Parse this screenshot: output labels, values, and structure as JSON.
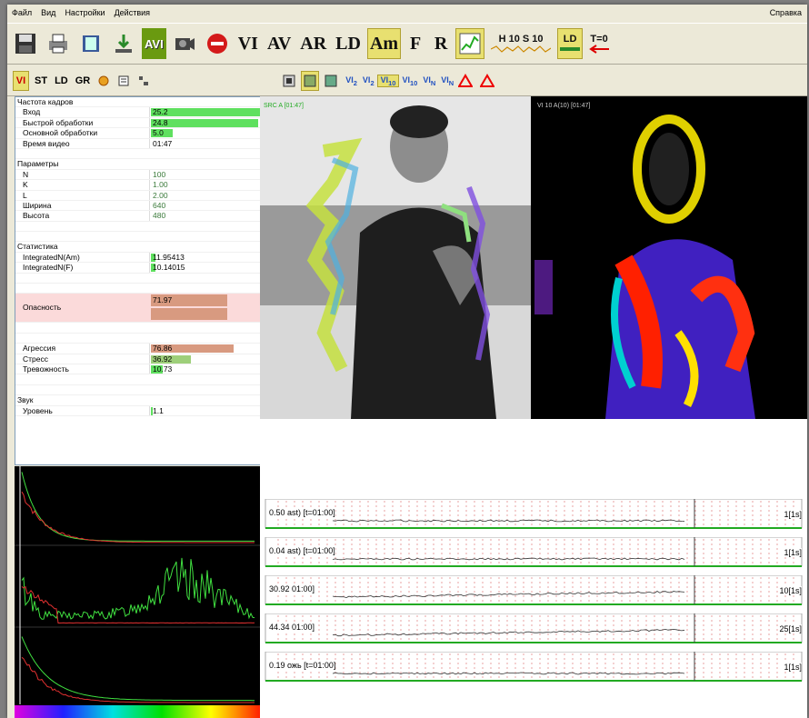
{
  "menu": {
    "items": [
      "Файл",
      "Вид",
      "Настройки",
      "Действия"
    ],
    "help": "Справка"
  },
  "toolbar": {
    "avi": "AVI",
    "vi": "VI",
    "av": "AV",
    "ar": "AR",
    "ld": "LD",
    "am": "Am",
    "f": "F",
    "r": "R",
    "h10": "H 10",
    "s10": "S 10",
    "ld_small": "LD",
    "t0": "T=0"
  },
  "toolbar2": {
    "vi": "VI",
    "st": "ST",
    "ld": "LD",
    "gr": "GR",
    "vi_buttons": [
      "VI",
      "VI",
      "VI",
      "VI",
      "VI",
      "VI"
    ],
    "vi_subs": [
      "2",
      "2",
      "10",
      "10",
      "N",
      "N"
    ]
  },
  "props": {
    "sections": {
      "frames": "Частота кадров",
      "params": "Параметры",
      "stats": "Статистика",
      "sound": "Звук"
    },
    "frames": [
      {
        "k": "Вход",
        "v": "25.2",
        "fill": 1.0
      },
      {
        "k": "Быстрой обработки",
        "v": "24.8",
        "fill": 0.98
      },
      {
        "k": "Основной обработки",
        "v": "5.0",
        "fill": 0.2
      },
      {
        "k": "Время видео",
        "v": "01:47"
      }
    ],
    "params": [
      {
        "k": "N",
        "v": "100"
      },
      {
        "k": "K",
        "v": "1.00"
      },
      {
        "k": "L",
        "v": "2.00"
      },
      {
        "k": "Ширина",
        "v": "640"
      },
      {
        "k": "Высота",
        "v": "480"
      }
    ],
    "stats": [
      {
        "k": "IntegratedN(Am)",
        "v": "11.95413"
      },
      {
        "k": "IntegratedN(F)",
        "v": "10.14015"
      }
    ],
    "danger": {
      "k": "Опасность",
      "v": "71.97"
    },
    "emotions": [
      {
        "k": "Агрессия",
        "v": "76.86",
        "fill": 0.77
      },
      {
        "k": "Стресс",
        "v": "36.92",
        "fill": 0.37
      },
      {
        "k": "Тревожность",
        "v": "10.73",
        "fill": 0.11
      }
    ],
    "sound": [
      {
        "k": "Уровень",
        "v": "1.1"
      }
    ]
  },
  "video": {
    "left_caption": "SRC A [01:47]",
    "right_caption": "VI 10 A(10) [01:47]"
  },
  "waves": [
    {
      "label": "0.50 ast) [t=01:00]",
      "right": "1[1s]"
    },
    {
      "label": "0.04 ast) [t=01:00]",
      "right": "1[1s]"
    },
    {
      "label": "30.92 01:00]",
      "right": "10[1s]"
    },
    {
      "label": "44.34 01:00]",
      "right": "25[1s]"
    },
    {
      "label": "0.19 ожь [t=01:00]",
      "right": "1[1s]"
    }
  ],
  "colors": {
    "green_bar": "#5fe05f",
    "salmon_bar": "#d89a80",
    "danger_bg": "#fbdada",
    "stress_bar": "#9ecf7a"
  }
}
